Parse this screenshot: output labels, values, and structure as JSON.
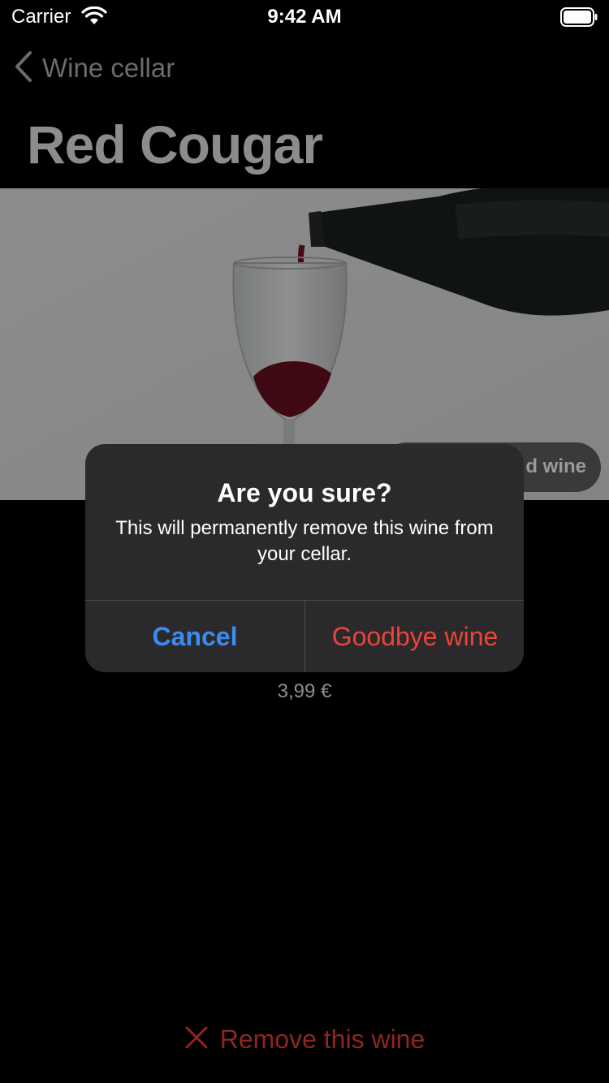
{
  "status_bar": {
    "carrier": "Carrier",
    "time": "9:42 AM",
    "icons": [
      "wifi-icon",
      "battery-icon"
    ]
  },
  "nav": {
    "back_label": "Wine cellar",
    "back_icon": "chevron-left-icon"
  },
  "page": {
    "title": "Red Cougar"
  },
  "hero": {
    "image_name": "wine-pour-photo",
    "button_label": "d wine"
  },
  "details": {
    "price": "3,99 €"
  },
  "remove": {
    "label": "Remove this wine",
    "icon": "x-icon",
    "color": "#8e2620"
  },
  "alert": {
    "title": "Are you sure?",
    "message": "This will permanently remove this wine from your cellar.",
    "cancel_label": "Cancel",
    "confirm_label": "Goodbye wine",
    "cancel_color": "#3c8bf2",
    "confirm_color": "#eb4339"
  }
}
